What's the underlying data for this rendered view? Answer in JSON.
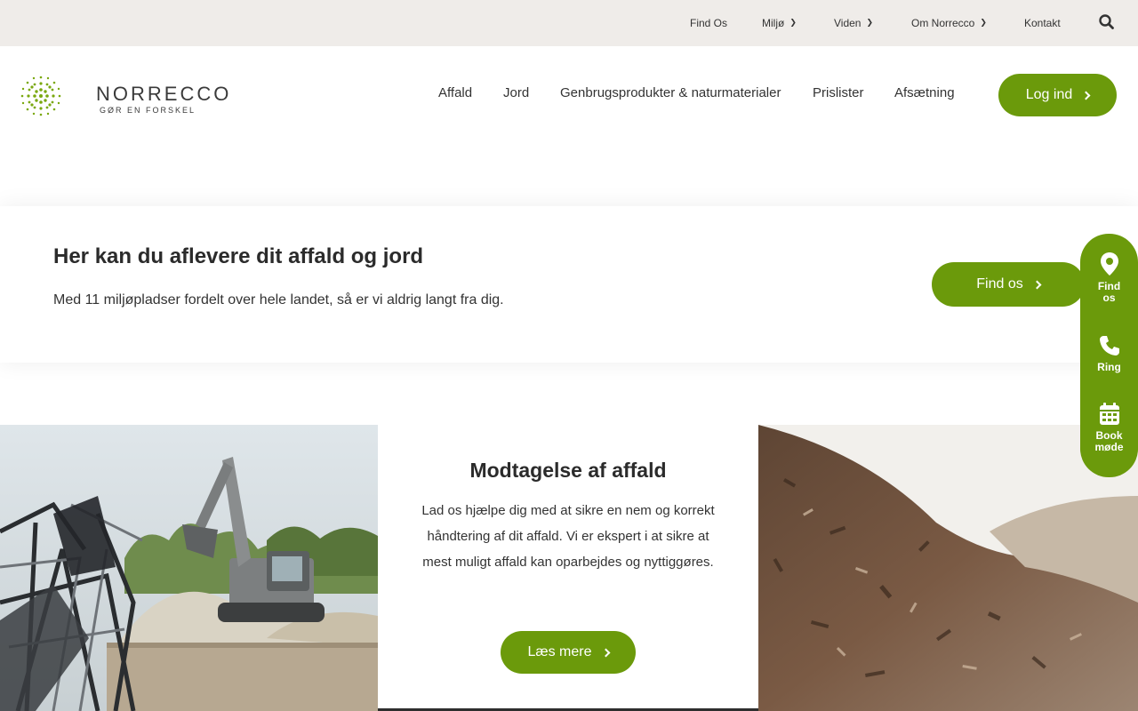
{
  "topbar": {
    "links": [
      {
        "label": "Find Os"
      },
      {
        "label": "Miljø"
      },
      {
        "label": "Viden"
      },
      {
        "label": "Om Norrecco"
      },
      {
        "label": "Kontakt"
      }
    ],
    "search_icon": "search-icon"
  },
  "header": {
    "logo_name": "NORRECCO",
    "logo_tagline": "GØR EN FORSKEL",
    "nav": [
      {
        "label": "Affald"
      },
      {
        "label": "Jord"
      },
      {
        "label": "Genbrugsprodukter & naturmaterialer"
      },
      {
        "label": "Prislister"
      },
      {
        "label": "Afsætning"
      }
    ],
    "login_label": "Log ind"
  },
  "findband": {
    "title": "Her kan du aflevere dit affald og jord",
    "text": "Med 11 miljøpladser fordelt over hele landet, så er vi aldrig langt fra dig.",
    "button_label": "Find os"
  },
  "sidepanel": {
    "items": [
      {
        "label_line1": "Find",
        "label_line2": "os",
        "icon": "map-pin-icon"
      },
      {
        "label_line1": "Ring",
        "label_line2": "",
        "icon": "phone-icon"
      },
      {
        "label_line1": "Book",
        "label_line2": "møde",
        "icon": "calendar-icon"
      }
    ]
  },
  "card": {
    "title": "Modtagelse af affald",
    "text": "Lad os hjælpe dig med at sikre en nem og korrekt håndtering af dit affald. Vi er ekspert i at sikre at mest muligt affald kan oparbejdes og nyttiggøres.",
    "button_label": "Læs mere"
  },
  "colors": {
    "brand_green": "#6b9a0b",
    "topbar_bg": "#efece9",
    "text_dark": "#2b2b2b"
  }
}
